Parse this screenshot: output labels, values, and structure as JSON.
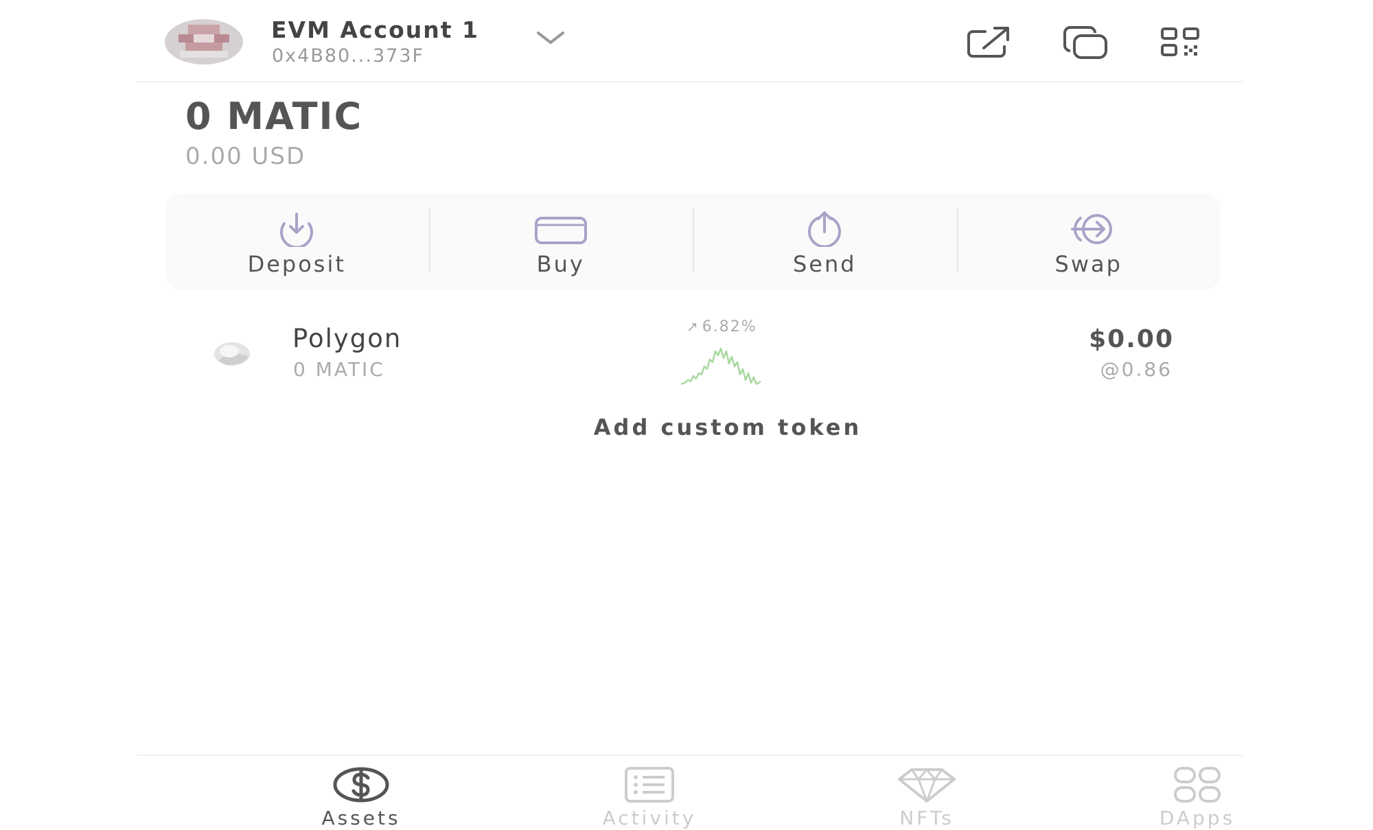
{
  "header": {
    "account_name": "EVM Account 1",
    "account_address": "0x4B80...373F",
    "icons": [
      "external-link-icon",
      "copy-icon",
      "qr-code-icon"
    ]
  },
  "balance": {
    "amount": "0 MATIC",
    "fiat": "0.00 USD"
  },
  "actions": [
    {
      "label": "Deposit",
      "icon": "deposit-icon"
    },
    {
      "label": "Buy",
      "icon": "card-icon"
    },
    {
      "label": "Send",
      "icon": "send-icon"
    },
    {
      "label": "Swap",
      "icon": "swap-icon"
    }
  ],
  "tokens": [
    {
      "name": "Polygon",
      "amount": "0 MATIC",
      "change": "6.82%",
      "value": "$0.00",
      "price": "@0.86",
      "icon": "polygon-token-icon",
      "change_color": "#a8d8a0"
    }
  ],
  "add_token_label": "Add custom token",
  "bottom_nav": [
    {
      "label": "Assets",
      "icon": "dollar-circle-icon",
      "active": true
    },
    {
      "label": "Activity",
      "icon": "list-icon",
      "active": false
    },
    {
      "label": "NFTs",
      "icon": "diamond-icon",
      "active": false
    },
    {
      "label": "DApps",
      "icon": "grid-icon",
      "active": false
    }
  ],
  "colors": {
    "accent": "#a8a3c8",
    "text_primary": "#444444",
    "text_muted": "#aaaaaa"
  }
}
